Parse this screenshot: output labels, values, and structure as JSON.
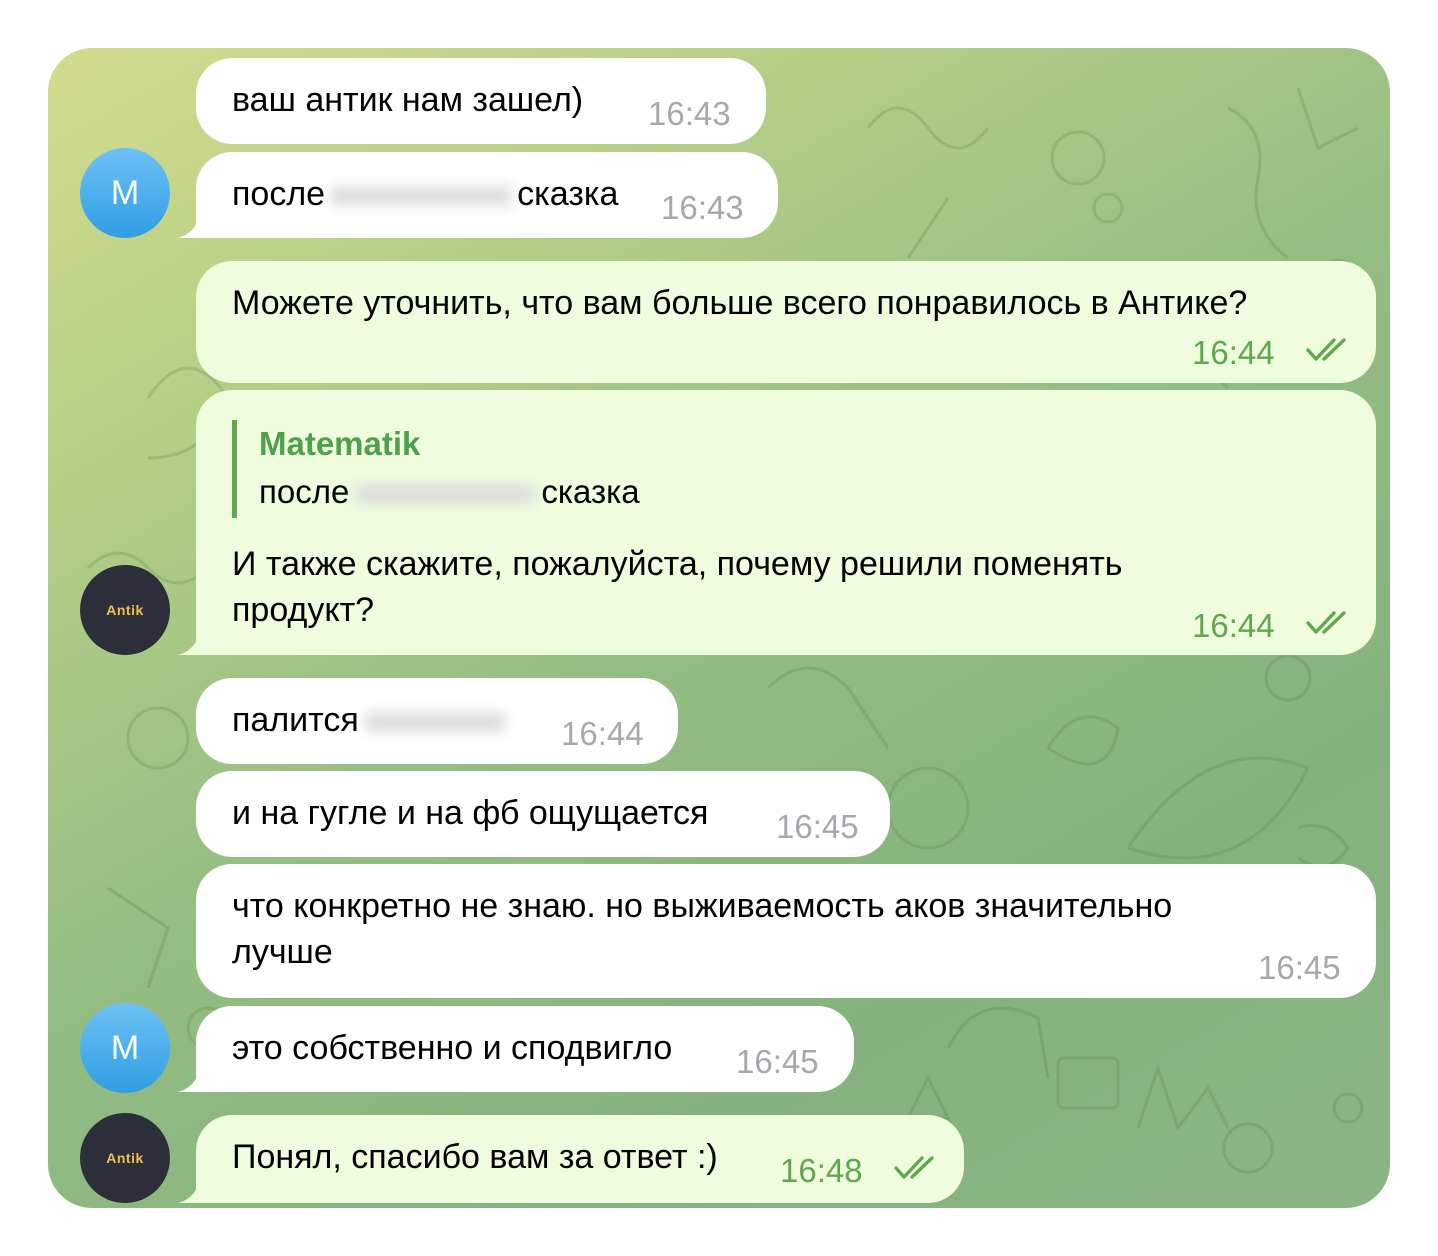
{
  "chat": {
    "background_colors": [
      "#d3dc8e",
      "#94bd82",
      "#84b27e"
    ],
    "bubble_in_color": "#ffffff",
    "bubble_out_color": "#effdde",
    "avatars": {
      "m_initial": "M",
      "antik_logo": "Antik"
    },
    "messages": [
      {
        "text": "ваш антик нам зашел)",
        "time": "16:43"
      },
      {
        "text_before": "после",
        "text_after": "сказка",
        "time": "16:43"
      },
      {
        "text": "Можете уточнить, что вам больше всего понравилось в Антике?",
        "time": "16:44",
        "status": "read"
      },
      {
        "reply_name": "Matematik",
        "reply_text_before": "после",
        "reply_text_after": "сказка",
        "line1": "И также скажите, пожалуйста, почему решили поменять",
        "line2": "продукт?",
        "time": "16:44",
        "status": "read"
      },
      {
        "text": "палится",
        "time": "16:44"
      },
      {
        "text": "и на гугле и на фб ощущается",
        "time": "16:45"
      },
      {
        "line1": "что конкретно не знаю. но выживаемость аков значительно",
        "line2": "лучше",
        "time": "16:45"
      },
      {
        "text": "это собственно и сподвигло",
        "time": "16:45"
      },
      {
        "text": "Понял, спасибо вам за ответ :)",
        "time": "16:48",
        "status": "read"
      }
    ]
  }
}
